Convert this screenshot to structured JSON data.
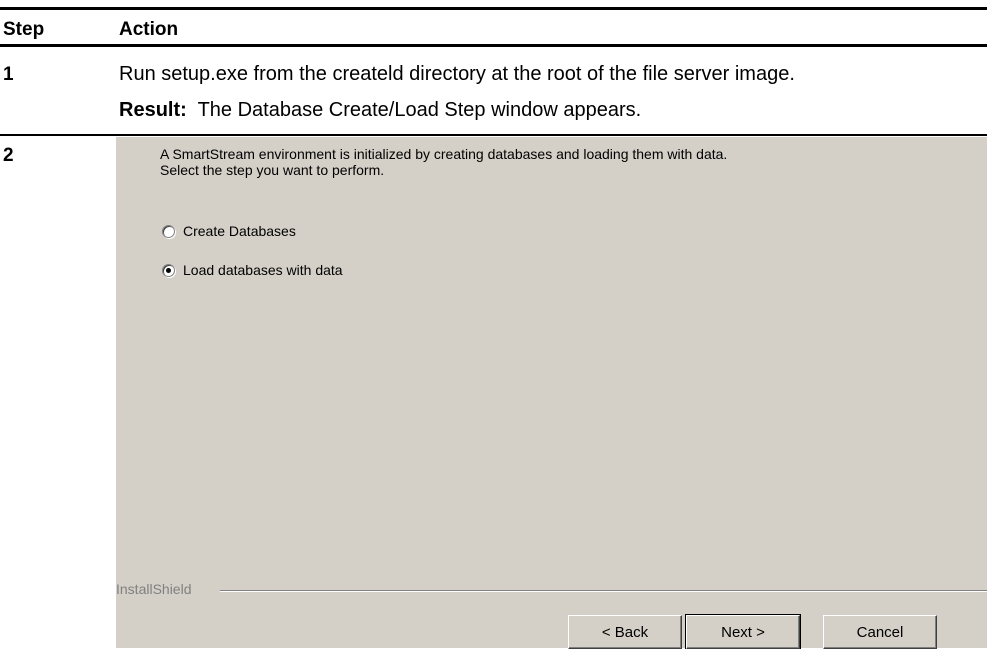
{
  "table": {
    "headers": {
      "step": "Step",
      "action": "Action"
    },
    "rows": [
      {
        "step": "1",
        "action": "Run setup.exe from the createld directory at the root of the file server image.",
        "result_label": "Result:",
        "result_text": "The Database Create/Load Step window appears."
      },
      {
        "step": "2"
      }
    ]
  },
  "dialog": {
    "intro_line1": "A SmartStream environment is initialized by creating databases and loading them with data.",
    "intro_line2": "Select the step you want to perform.",
    "options": [
      {
        "label": "Create Databases",
        "selected": false
      },
      {
        "label": "Load databases with data",
        "selected": true
      }
    ],
    "brand": "InstallShield",
    "buttons": {
      "back": "< Back",
      "next": "Next >",
      "cancel": "Cancel"
    }
  }
}
